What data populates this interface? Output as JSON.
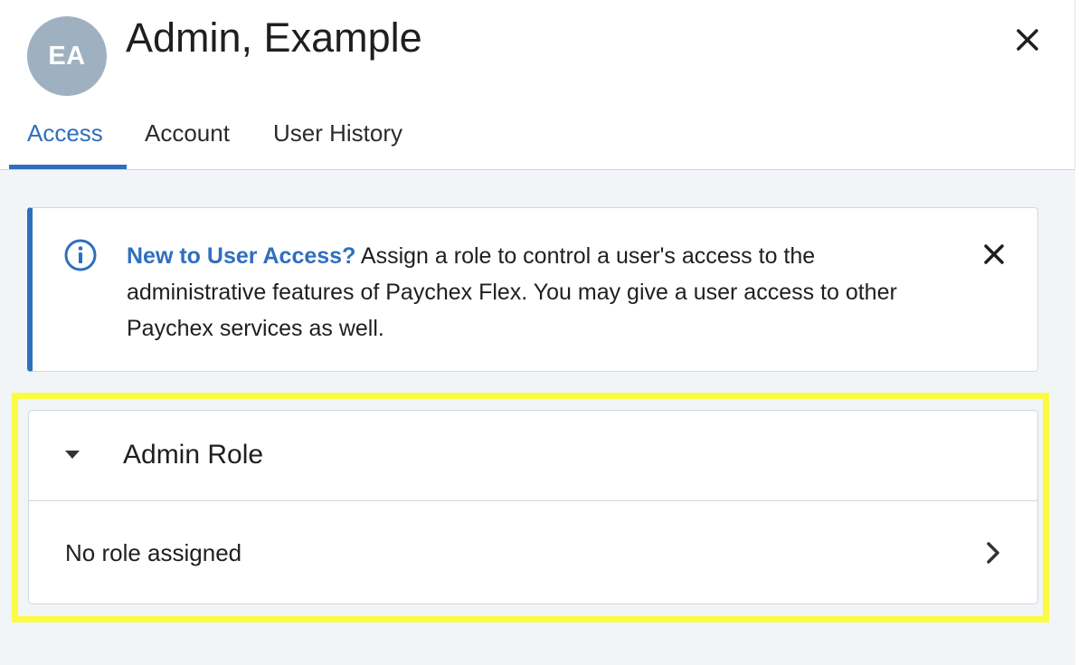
{
  "user": {
    "initials": "EA",
    "name": "Admin, Example"
  },
  "tabs": [
    {
      "label": "Access",
      "active": true
    },
    {
      "label": "Account",
      "active": false
    },
    {
      "label": "User History",
      "active": false
    }
  ],
  "banner": {
    "lead": "New to User Access?",
    "text": " Assign a role to control a user's access to the administrative features of Paychex Flex. You may give a user access to other Paychex services as well.",
    "icon": "info-icon"
  },
  "admin_role": {
    "title": "Admin Role",
    "value": "No role assigned",
    "expanded": true
  },
  "colors": {
    "accent": "#2f6fbd",
    "avatar": "#9fb1c1",
    "highlight": "#fbfb44",
    "body_bg": "#f2f5f8"
  }
}
